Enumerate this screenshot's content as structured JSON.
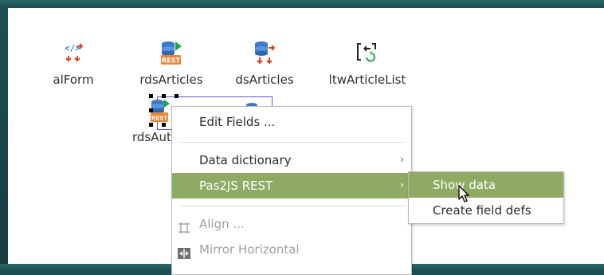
{
  "components": [
    {
      "name": "alForm",
      "icon": "form-component-icon"
    },
    {
      "name": "rdsArticles",
      "icon": "rest-datasource-icon"
    },
    {
      "name": "dsArticles",
      "icon": "datasource-icon"
    },
    {
      "name": "ltwArticleList",
      "icon": "list-widget-icon"
    },
    {
      "name": "rdsAut",
      "icon": "rest-datasource-icon"
    }
  ],
  "context_menu": {
    "items": [
      {
        "label": "Edit Fields ...",
        "enabled": true
      },
      {
        "label": "Data dictionary",
        "enabled": true,
        "submenu": true
      },
      {
        "label": "Pas2JS REST",
        "enabled": true,
        "submenu": true,
        "highlighted": true
      },
      {
        "label": "Align ...",
        "enabled": false,
        "icon": "align-icon"
      },
      {
        "label": "Mirror Horizontal",
        "enabled": false,
        "icon": "mirror-horizontal-icon"
      }
    ],
    "arrow": "›"
  },
  "submenu": {
    "items": [
      {
        "label": "Show data",
        "highlighted": true
      },
      {
        "label": "Create field defs",
        "highlighted": false
      }
    ]
  },
  "colors": {
    "highlight": "#8fab63",
    "selection": "#5b5bd0",
    "accent_green": "#1fa84a",
    "accent_red": "#d9472b",
    "db_blue": "#3a78c9"
  }
}
